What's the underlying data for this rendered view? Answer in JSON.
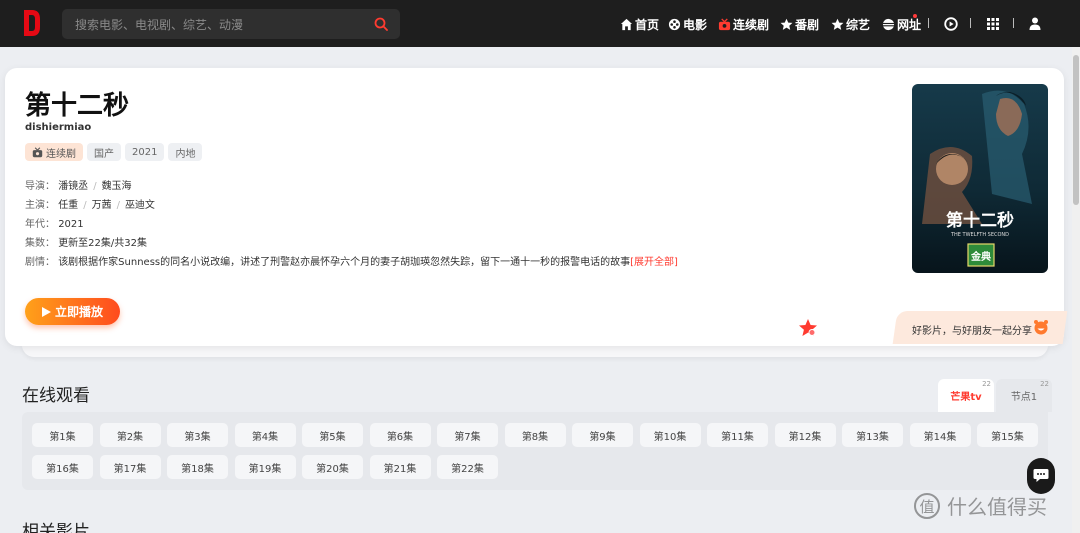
{
  "header": {
    "logo_letter": "D",
    "search_placeholder": "搜索电影、电视剧、综艺、动漫",
    "nav": [
      {
        "label": "首页",
        "icon": "home-icon"
      },
      {
        "label": "电影",
        "icon": "film-reel-icon"
      },
      {
        "label": "连续剧",
        "icon": "tv-icon"
      },
      {
        "label": "番剧",
        "icon": "star-icon"
      },
      {
        "label": "综艺",
        "icon": "star-icon"
      },
      {
        "label": "网址",
        "icon": "globe-icon"
      }
    ],
    "right_icons": [
      "play-circle-icon",
      "grid-icon",
      "user-icon"
    ]
  },
  "detail": {
    "title": "第十二秒",
    "pinyin": "dishiermiao",
    "tags": [
      "连续剧",
      "国产",
      "2021",
      "内地"
    ],
    "director_label": "导演：",
    "directors": [
      "潘镜丞",
      "魏玉海"
    ],
    "cast_label": "主演：",
    "cast": [
      "任重",
      "万茜",
      "巫迪文"
    ],
    "year_label": "年代：",
    "year": "2021",
    "episodes_label": "集数：",
    "episodes": "更新至22集/共32集",
    "plot_label": "剧情：",
    "plot": "该剧根据作家Sunness的同名小说改编，讲述了刑警赵亦晨怀孕六个月的妻子胡珈瑛忽然失踪，留下一通十一秒的报警电话的故事",
    "plot_more": "[展开全部]",
    "play_label": "立即播放",
    "share_text": "好影片，与好朋友一起分享",
    "poster_title": "第十二秒",
    "poster_subtitle": "THE TWELFTH SECOND",
    "poster_badge": "金典"
  },
  "online": {
    "section_title": "在线观看",
    "sources": [
      {
        "label": "芒果tv",
        "count": "22",
        "active": true
      },
      {
        "label": "节点1",
        "count": "22",
        "active": false
      }
    ],
    "episodes": [
      "第1集",
      "第2集",
      "第3集",
      "第4集",
      "第5集",
      "第6集",
      "第7集",
      "第8集",
      "第9集",
      "第10集",
      "第11集",
      "第12集",
      "第13集",
      "第14集",
      "第15集",
      "第16集",
      "第17集",
      "第18集",
      "第19集",
      "第20集",
      "第21集",
      "第22集"
    ]
  },
  "related_title": "相关影片",
  "watermark": "什么值得买",
  "colors": {
    "accent": "#ff3b30",
    "play_start": "#ffa11a",
    "play_end": "#ff4b1e",
    "topbar": "#1e1e1e"
  }
}
